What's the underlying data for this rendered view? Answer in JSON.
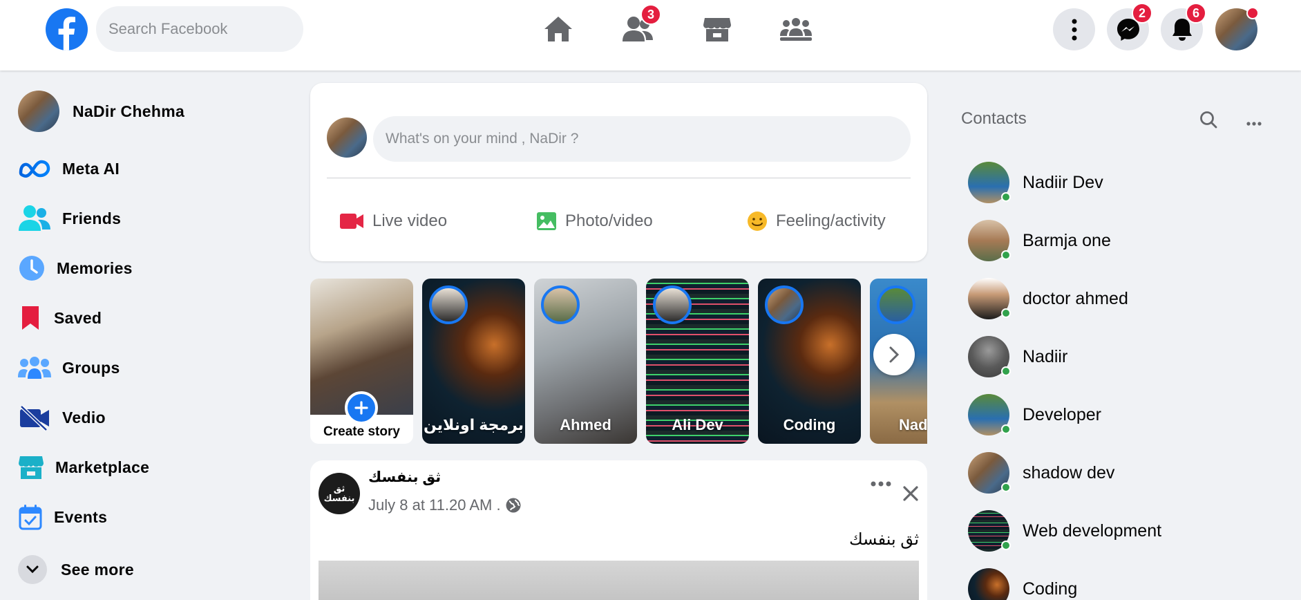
{
  "header": {
    "search_placeholder": "Search Facebook",
    "friends_badge": "3",
    "messenger_badge": "2",
    "notifications_badge": "6"
  },
  "sidebar": {
    "user_name": "NaDir Chehma",
    "items": [
      {
        "label": "Meta AI",
        "icon": "meta-ai-icon"
      },
      {
        "label": "Friends",
        "icon": "friends-icon"
      },
      {
        "label": "Memories",
        "icon": "clock-icon"
      },
      {
        "label": "Saved",
        "icon": "bookmark-icon"
      },
      {
        "label": "Groups",
        "icon": "groups-icon"
      },
      {
        "label": "Vedio",
        "icon": "video-off-icon"
      },
      {
        "label": "Marketplace",
        "icon": "store-icon"
      },
      {
        "label": "Events",
        "icon": "calendar-icon"
      },
      {
        "label": "See more",
        "icon": "chevron-down-icon"
      }
    ]
  },
  "composer": {
    "placeholder": "What's on your mind , NaDir ?",
    "actions": [
      {
        "label": "Live video",
        "color": "#e42645"
      },
      {
        "label": "Photo/video",
        "color": "#45bd62"
      },
      {
        "label": "Feeling/activity",
        "color": "#f7b928"
      }
    ]
  },
  "stories": {
    "create_label": "Create story",
    "items": [
      {
        "name": "برمجة اونلاين"
      },
      {
        "name": "Ahmed"
      },
      {
        "name": "Ali Dev"
      },
      {
        "name": "Coding"
      },
      {
        "name": "Nad"
      }
    ]
  },
  "post": {
    "page_name": "ثق بنفسك",
    "avatar_text": "ثق\nبنفسك",
    "timestamp": "July 8 at 11.20 AM .",
    "text": "ثق بنفسك"
  },
  "contacts": {
    "title": "Contacts",
    "items": [
      {
        "name": "Nadiir Dev"
      },
      {
        "name": "Barmja one"
      },
      {
        "name": "doctor ahmed"
      },
      {
        "name": "Nadiir"
      },
      {
        "name": "Developer"
      },
      {
        "name": "shadow dev"
      },
      {
        "name": "Web development"
      },
      {
        "name": "Coding"
      }
    ]
  },
  "colors": {
    "brand": "#1877f2",
    "badge": "#e41e3f",
    "online": "#31a24c",
    "page_bg": "#f0f2f5"
  }
}
